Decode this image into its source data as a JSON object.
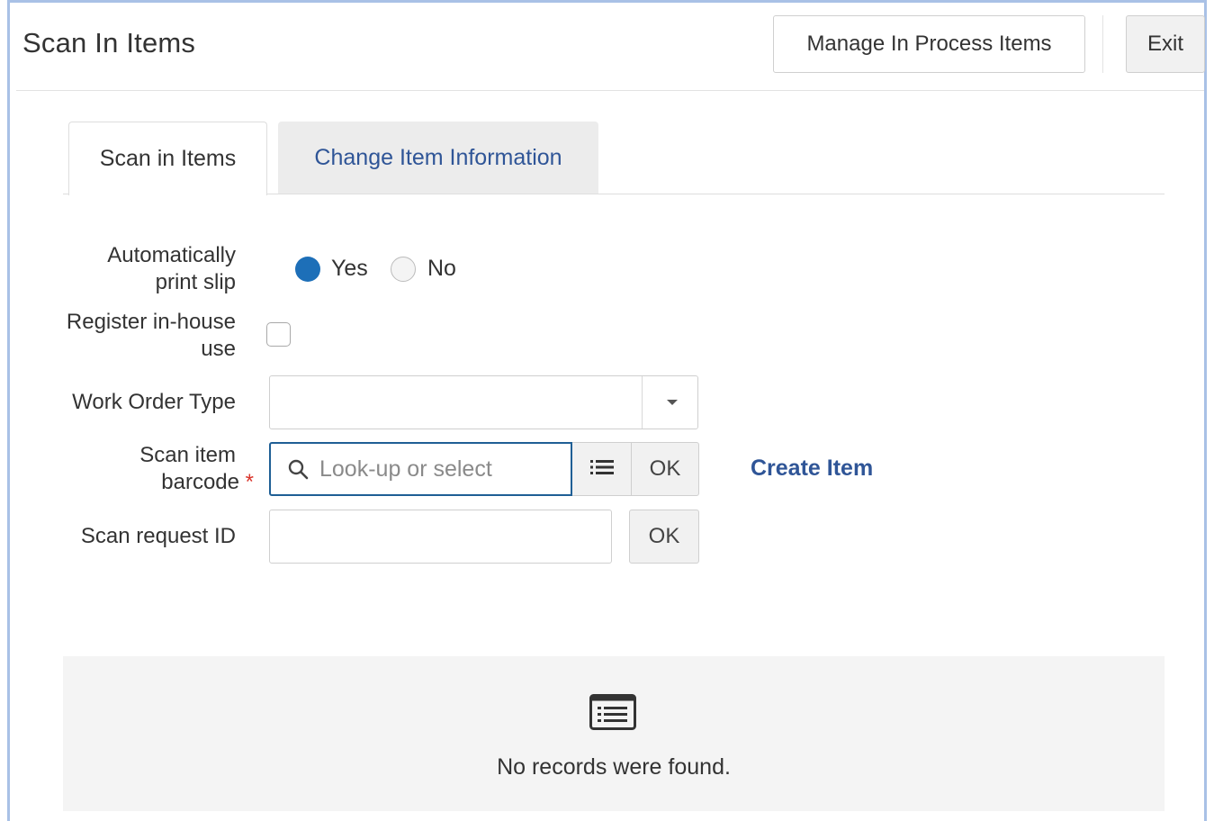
{
  "header": {
    "title": "Scan In Items",
    "manage_label": "Manage In Process Items",
    "exit_label": "Exit"
  },
  "tabs": [
    {
      "label": "Scan in Items",
      "active": true
    },
    {
      "label": "Change Item Information",
      "active": false
    }
  ],
  "form": {
    "auto_print": {
      "label_line1": "Automatically",
      "label_line2": "print slip",
      "options": [
        {
          "label": "Yes",
          "selected": true
        },
        {
          "label": "No",
          "selected": false
        }
      ]
    },
    "register_inhouse": {
      "label_line1": "Register in-house",
      "label_line2": "use",
      "checked": false
    },
    "work_order_type": {
      "label": "Work Order Type",
      "value": ""
    },
    "scan_barcode": {
      "label_line1": "Scan item",
      "label_line2": "barcode",
      "required_mark": "*",
      "placeholder": "Look-up or select",
      "value": "",
      "ok_label": "OK"
    },
    "create_item_label": "Create Item",
    "scan_request": {
      "label": "Scan request ID",
      "value": "",
      "ok_label": "OK"
    }
  },
  "results": {
    "empty_message": "No records were found."
  },
  "colors": {
    "accent": "#1d6fb8",
    "link": "#2f5597",
    "focus_border": "#1f5f95",
    "required": "#d9342b",
    "frame": "#a9c1e6"
  },
  "icons": {
    "search": "search-icon",
    "list": "list-icon",
    "dropdown": "chevron-down-icon",
    "empty": "records-list-icon"
  }
}
